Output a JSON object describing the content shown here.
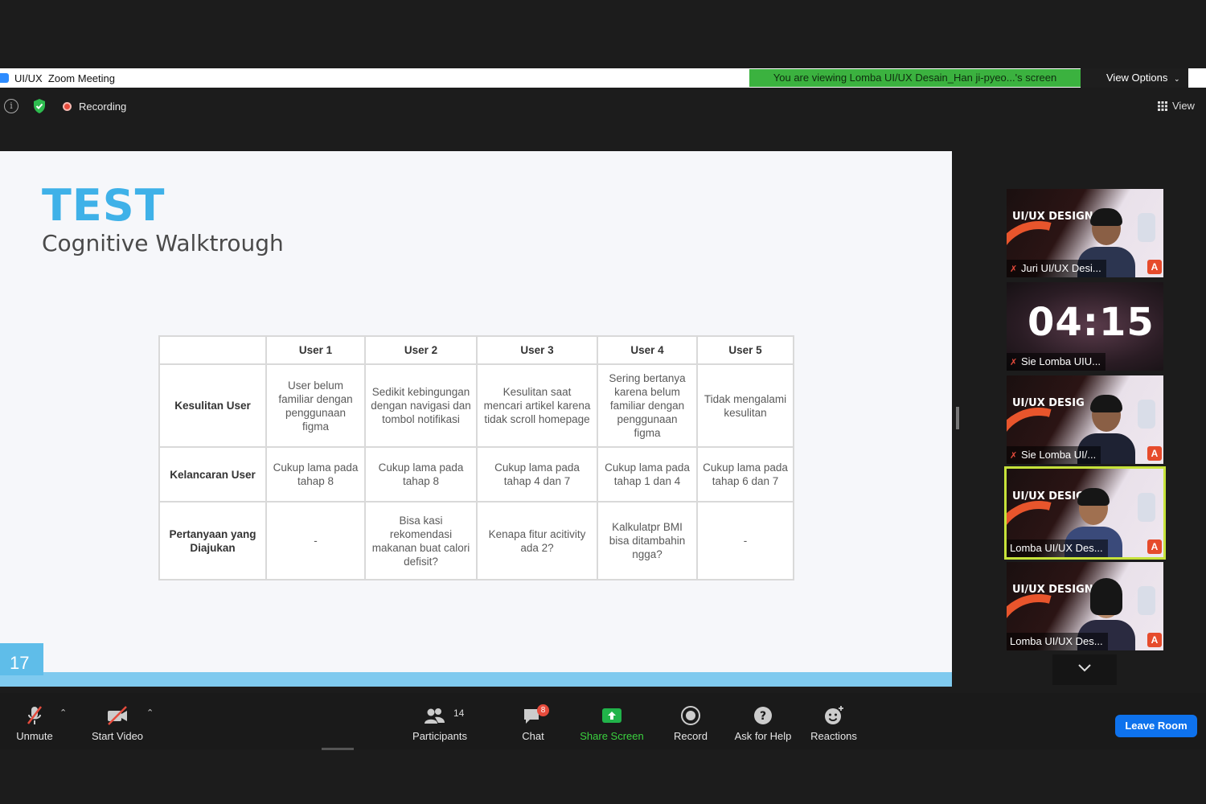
{
  "window": {
    "title": "UI/UX  Zoom Meeting",
    "share_banner": "You are viewing Lomba UI/UX Desain_Han ji-pyeo...'s screen",
    "view_options": "View Options"
  },
  "meeting_bar": {
    "recording_label": "Recording",
    "view_label": "View"
  },
  "slide": {
    "heading": "TEST",
    "subheading": "Cognitive Walktrough",
    "page_number": "17",
    "table": {
      "columns": [
        "",
        "User 1",
        "User 2",
        "User 3",
        "User 4",
        "User 5"
      ],
      "rows": [
        {
          "label": "Kesulitan User",
          "cells": [
            "User belum familiar dengan penggunaan figma",
            "Sedikit kebingungan dengan navigasi dan tombol notifikasi",
            "Kesulitan saat mencari artikel karena tidak scroll homepage",
            "Sering bertanya karena belum familiar dengan penggunaan figma",
            "Tidak mengalami kesulitan"
          ]
        },
        {
          "label": "Kelancaran User",
          "cells": [
            "Cukup lama pada tahap 8",
            "Cukup lama pada tahap 8",
            "Cukup lama pada tahap 4 dan 7",
            "Cukup lama pada tahap 1 dan 4",
            "Cukup lama pada tahap 6 dan 7"
          ]
        },
        {
          "label": "Pertanyaan yang Diajukan",
          "cells": [
            "-",
            "Bisa kasi rekomendasi makanan buat calori defisit?",
            "Kenapa fitur acitivity ada 2?",
            "Kalkulatpr BMI bisa ditambahin ngga?",
            "-"
          ]
        }
      ]
    }
  },
  "participants": [
    {
      "name": "Juri UI/UX Desi...",
      "brand": "UI/UX DESIGN",
      "muted": true
    },
    {
      "name": "Sie Lomba UIU...",
      "timer": "04:15",
      "muted": true
    },
    {
      "name": "Sie Lomba UI/...",
      "brand": "UI/UX DESIG",
      "muted": true
    },
    {
      "name": "Lomba UI/UX Des...",
      "brand": "UI/UX DESIGN",
      "muted": false,
      "active": true
    },
    {
      "name": "Lomba UI/UX Des...",
      "brand": "UI/UX DESIGN",
      "muted": false
    }
  ],
  "toolbar": {
    "unmute": "Unmute",
    "start_video": "Start Video",
    "participants": "Participants",
    "participants_count": "14",
    "chat": "Chat",
    "chat_badge": "8",
    "share_screen": "Share Screen",
    "record": "Record",
    "ask_for_help": "Ask for Help",
    "reactions": "Reactions",
    "leave_room": "Leave Room"
  },
  "colors": {
    "accent_blue": "#3fb1e8",
    "share_green": "#3bb23f",
    "leave_blue": "#0e72ed",
    "active_speaker": "#c6e23a"
  }
}
